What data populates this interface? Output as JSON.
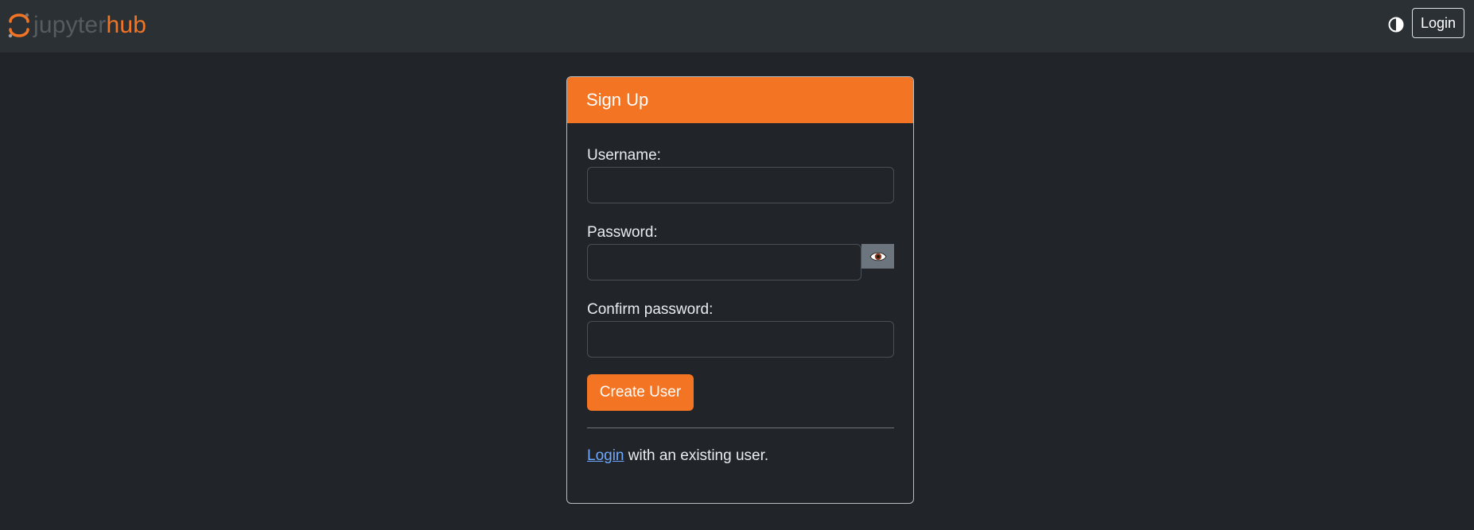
{
  "navbar": {
    "logo": {
      "part1": "jupyter",
      "part2": "hub",
      "icon": "jupyter-logo-icon"
    },
    "theme_toggle_icon": "contrast-icon",
    "login_label": "Login"
  },
  "signup": {
    "title": "Sign Up",
    "username_label": "Username:",
    "username_value": "",
    "password_label": "Password:",
    "password_value": "",
    "show_password_icon": "eye-icon",
    "confirm_label": "Confirm password:",
    "confirm_value": "",
    "submit_label": "Create User",
    "footer_link": "Login",
    "footer_text": " with an existing user."
  },
  "colors": {
    "brand": "#f37524",
    "background": "#212529",
    "navbar": "#2b3035",
    "link": "#6ea8fe"
  }
}
